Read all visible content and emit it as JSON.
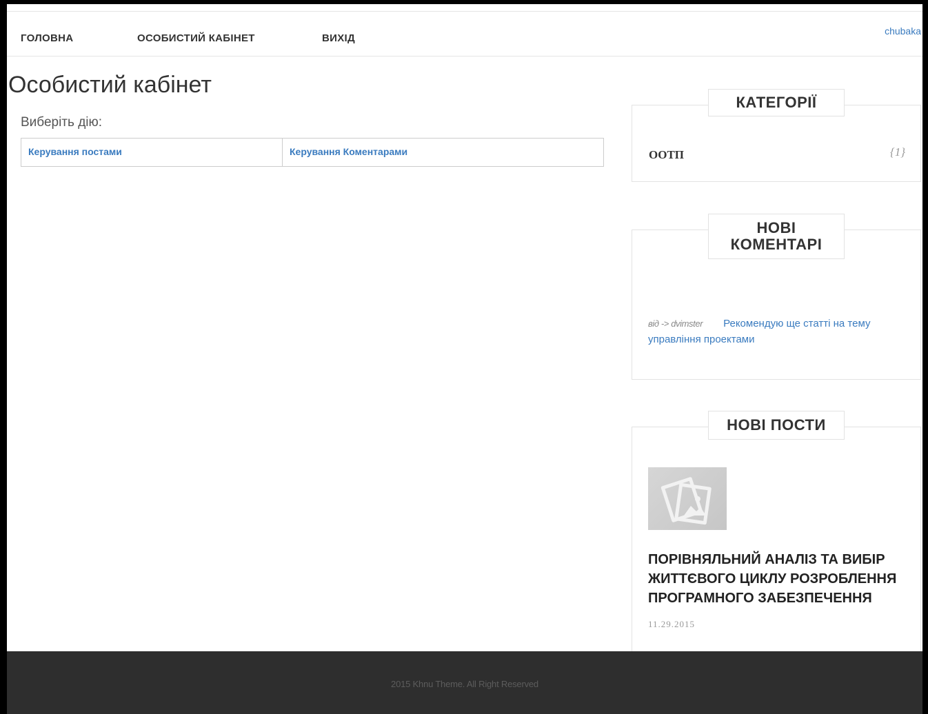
{
  "nav": {
    "items": [
      {
        "label": "ГОЛОВНА"
      },
      {
        "label": "ОСОБИСТИЙ КАБІНЕТ"
      },
      {
        "label": "ВИХІД"
      }
    ],
    "user": "chubaka"
  },
  "main": {
    "title": "Особистий кабінет",
    "choose_label": "Виберіть дію:",
    "actions": [
      "Керування постами",
      "Керування Коментарами"
    ]
  },
  "sidebar": {
    "categories": {
      "title": "КАТЕГОРІЇ",
      "items": [
        {
          "name": "ООТП",
          "count": "{1}"
        }
      ]
    },
    "comments": {
      "title_line1": "НОВІ",
      "title_line2": "КОМЕНТАРІ",
      "items": [
        {
          "author": "від -> dvimster",
          "text": "Рекомендую ще статті на тему управління проектами"
        }
      ]
    },
    "posts": {
      "title": "НОВІ ПОСТИ",
      "items": [
        {
          "title": "ПОРІВНЯЛЬНИЙ АНАЛІЗ ТА ВИБІР ЖИТТЄВОГО ЦИКЛУ РОЗРОБЛЕННЯ ПРОГРАМНОГО ЗАБЕЗПЕЧЕННЯ",
          "date": "11.29.2015",
          "thumb_icon": "image-placeholder-icon"
        }
      ]
    }
  },
  "footer": {
    "text": "2015 Khnu Theme. All Right Reserved"
  }
}
